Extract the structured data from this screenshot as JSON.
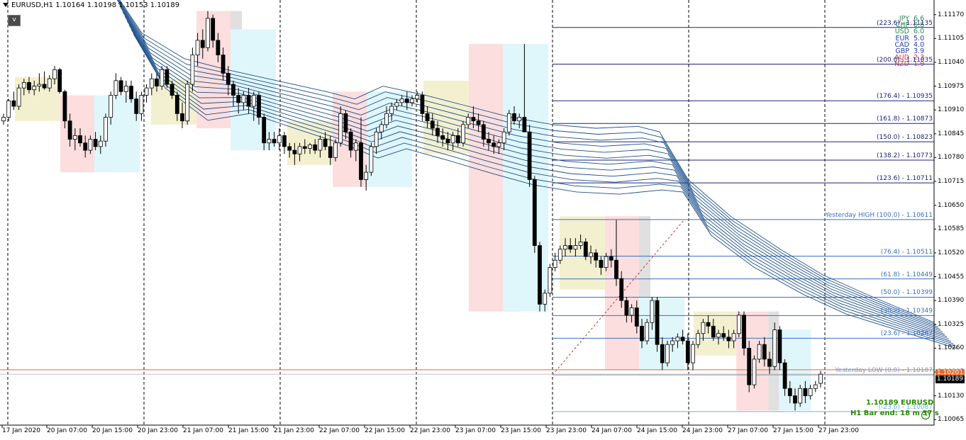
{
  "header": {
    "title": "EURUSD,H1  1.10164 1.10198 1.10153 1.10189"
  },
  "oneclick_label": "v",
  "strength": [
    {
      "ccy": "JPY",
      "val": "6.6",
      "color": "#2e8b57"
    },
    {
      "ccy": "CHF",
      "val": "6.6",
      "color": "#2e8b57"
    },
    {
      "ccy": "USD",
      "val": "6.0",
      "color": "#2e8b57"
    },
    {
      "ccy": "EUR",
      "val": "5.0",
      "color": "#1f3fa8"
    },
    {
      "ccy": "CAD",
      "val": "4.0",
      "color": "#1f3fa8"
    },
    {
      "ccy": "GBP",
      "val": "3.9",
      "color": "#1f3fa8"
    },
    {
      "ccy": "AUD",
      "val": "2.3",
      "color": "#e03030"
    },
    {
      "ccy": "NZD",
      "val": "1.9",
      "color": "#e03030"
    }
  ],
  "fib_levels": [
    {
      "label": "(223.6) - 1.11135",
      "price": 1.11135,
      "color": "#1a237e"
    },
    {
      "label": "(200.0) - 1.11035",
      "price": 1.11035,
      "color": "#1a237e"
    },
    {
      "label": "(176.4) - 1.10935",
      "price": 1.10935,
      "color": "#1a237e"
    },
    {
      "label": "(161.8) - 1.10873",
      "price": 1.10873,
      "color": "#1a237e"
    },
    {
      "label": "(150.0) - 1.10823",
      "price": 1.10823,
      "color": "#1a237e"
    },
    {
      "label": "(138.2) - 1.10773",
      "price": 1.10773,
      "color": "#1a237e"
    },
    {
      "label": "(123.6) - 1.10711",
      "price": 1.10711,
      "color": "#1a237e"
    },
    {
      "label": "Yesterday HIGH (100.0) - 1.10611",
      "price": 1.10611,
      "color": "#3a6fc4"
    },
    {
      "label": "(76.4) - 1.10511",
      "price": 1.10511,
      "color": "#3a6fc4"
    },
    {
      "label": "(61.8) - 1.10449",
      "price": 1.10449,
      "color": "#3a6fc4"
    },
    {
      "label": "(50.0) - 1.10399",
      "price": 1.10399,
      "color": "#3a6fc4"
    },
    {
      "label": "(38.2) - 1.10349",
      "price": 1.10349,
      "color": "#3a6fc4"
    },
    {
      "label": "(23.6) - 1.10287",
      "price": 1.10287,
      "color": "#3a6fc4"
    },
    {
      "label": "Yesterday LOW (0.0) - 1.10187",
      "price": 1.10187,
      "color": "#8899bb"
    },
    {
      "label": "(-23.6) - 1.10087",
      "price": 1.10087,
      "color": "#6ab0e0"
    }
  ],
  "price_ticks": [
    "1.11170",
    "1.11105",
    "1.11040",
    "1.10975",
    "1.10910",
    "1.10845",
    "1.10780",
    "1.10715",
    "1.10650",
    "1.10585",
    "1.10520",
    "1.10455",
    "1.10390",
    "1.10325",
    "1.10260",
    "1.10195",
    "1.10130",
    "1.10065"
  ],
  "time_ticks": [
    "17 Jan 2020",
    "20 Jan 07:00",
    "20 Jan 15:00",
    "20 Jan 23:00",
    "21 Jan 07:00",
    "21 Jan 15:00",
    "21 Jan 23:00",
    "22 Jan 07:00",
    "22 Jan 15:00",
    "22 Jan 23:00",
    "23 Jan 07:00",
    "23 Jan 15:00",
    "23 Jan 23:00",
    "24 Jan 07:00",
    "24 Jan 15:00",
    "24 Jan 23:00",
    "27 Jan 07:00",
    "27 Jan 15:00",
    "27 Jan 23:00"
  ],
  "current_price": {
    "bid": "1.10189",
    "ask": "1.10201"
  },
  "info": {
    "line1": "1.10189  EURUSD",
    "line2": "H1 Bar end: 18 m 37 s"
  },
  "colors": {
    "bull": "#ffffff",
    "bear": "#000000",
    "ribbon": "#1b4f8a",
    "bidline": "#c0c0c0",
    "askline": "#e8692b",
    "session_asia": "#f3f0d0",
    "session_london": "#fcdede",
    "session_ny": "#dff6fb",
    "overlap": "#e0e0e0"
  },
  "chart_data": {
    "type": "candlestick",
    "symbol": "EURUSD",
    "timeframe": "H1",
    "ylim": [
      1.1005,
      1.1121
    ],
    "candles": [
      [
        1.1088,
        1.109,
        1.1087,
        1.1089
      ],
      [
        1.1089,
        1.1094,
        1.1088,
        1.10935
      ],
      [
        1.10935,
        1.1096,
        1.1091,
        1.1092
      ],
      [
        1.1092,
        1.1098,
        1.1091,
        1.1097
      ],
      [
        1.1097,
        1.10995,
        1.1095,
        1.10985
      ],
      [
        1.10985,
        1.11,
        1.10955,
        1.10965
      ],
      [
        1.10965,
        1.1099,
        1.1095,
        1.10975
      ],
      [
        1.10975,
        1.1101,
        1.1096,
        1.1098
      ],
      [
        1.1098,
        1.11015,
        1.10965,
        1.1097
      ],
      [
        1.1097,
        1.11005,
        1.1096,
        1.10995
      ],
      [
        1.10995,
        1.1103,
        1.1098,
        1.1102
      ],
      [
        1.1102,
        1.11025,
        1.10955,
        1.1096
      ],
      [
        1.1096,
        1.10965,
        1.1086,
        1.1088
      ],
      [
        1.1088,
        1.109,
        1.1081,
        1.1083
      ],
      [
        1.1083,
        1.1086,
        1.108,
        1.1084
      ],
      [
        1.1084,
        1.1086,
        1.1081,
        1.1082
      ],
      [
        1.1082,
        1.1084,
        1.1078,
        1.108
      ],
      [
        1.108,
        1.1084,
        1.1079,
        1.1083
      ],
      [
        1.1083,
        1.1085,
        1.108,
        1.1081
      ],
      [
        1.1081,
        1.1084,
        1.1079,
        1.10825
      ],
      [
        1.10825,
        1.109,
        1.1081,
        1.1089
      ],
      [
        1.1089,
        1.1096,
        1.1087,
        1.1095
      ],
      [
        1.1095,
        1.1101,
        1.1094,
        1.1099
      ],
      [
        1.1099,
        1.11,
        1.1095,
        1.1096
      ],
      [
        1.1096,
        1.1099,
        1.1093,
        1.10975
      ],
      [
        1.10975,
        1.1099,
        1.1093,
        1.1094
      ],
      [
        1.1094,
        1.1096,
        1.1088,
        1.109
      ],
      [
        1.109,
        1.1096,
        1.1088,
        1.1095
      ],
      [
        1.1095,
        1.1098,
        1.1093,
        1.1097
      ],
      [
        1.1097,
        1.1101,
        1.1095,
        1.10995
      ],
      [
        1.10995,
        1.1101,
        1.1096,
        1.10975
      ],
      [
        1.10975,
        1.1103,
        1.10965,
        1.1102
      ],
      [
        1.1102,
        1.1103,
        1.1097,
        1.1098
      ],
      [
        1.1098,
        1.1099,
        1.1094,
        1.1095
      ],
      [
        1.1095,
        1.1096,
        1.1088,
        1.109
      ],
      [
        1.109,
        1.1093,
        1.1086,
        1.1088
      ],
      [
        1.1088,
        1.1099,
        1.1087,
        1.1098
      ],
      [
        1.1098,
        1.1108,
        1.1096,
        1.1106
      ],
      [
        1.1106,
        1.1112,
        1.1103,
        1.111
      ],
      [
        1.111,
        1.1113,
        1.1105,
        1.1108
      ],
      [
        1.1108,
        1.1118,
        1.1107,
        1.1116
      ],
      [
        1.1116,
        1.1117,
        1.1108,
        1.111
      ],
      [
        1.111,
        1.1112,
        1.1104,
        1.1106
      ],
      [
        1.1106,
        1.1108,
        1.1099,
        1.1101
      ],
      [
        1.1101,
        1.1103,
        1.1095,
        1.1098
      ],
      [
        1.1098,
        1.1099,
        1.1092,
        1.1095
      ],
      [
        1.1095,
        1.1097,
        1.109,
        1.1093
      ],
      [
        1.1093,
        1.1096,
        1.1091,
        1.1095
      ],
      [
        1.1095,
        1.1097,
        1.109,
        1.1092
      ],
      [
        1.1092,
        1.1096,
        1.1088,
        1.1095
      ],
      [
        1.1095,
        1.1096,
        1.1087,
        1.1089
      ],
      [
        1.1089,
        1.109,
        1.108,
        1.1082
      ],
      [
        1.1082,
        1.1085,
        1.108,
        1.1083
      ],
      [
        1.1083,
        1.1085,
        1.1081,
        1.1082
      ],
      [
        1.1082,
        1.1086,
        1.108,
        1.1084
      ],
      [
        1.1084,
        1.1085,
        1.1079,
        1.1081
      ],
      [
        1.1081,
        1.1082,
        1.1078,
        1.108
      ],
      [
        1.108,
        1.1082,
        1.1076,
        1.1079
      ],
      [
        1.1079,
        1.1082,
        1.1077,
        1.1081
      ],
      [
        1.1081,
        1.1083,
        1.1079,
        1.10805
      ],
      [
        1.10805,
        1.1082,
        1.1079,
        1.10815
      ],
      [
        1.10815,
        1.1083,
        1.1079,
        1.108
      ],
      [
        1.108,
        1.1084,
        1.1078,
        1.1083
      ],
      [
        1.1083,
        1.1085,
        1.108,
        1.1081
      ],
      [
        1.1081,
        1.1084,
        1.1076,
        1.1078
      ],
      [
        1.1078,
        1.1083,
        1.1077,
        1.1082
      ],
      [
        1.1082,
        1.1092,
        1.1081,
        1.109
      ],
      [
        1.109,
        1.1091,
        1.1083,
        1.1085
      ],
      [
        1.1085,
        1.1086,
        1.1078,
        1.108
      ],
      [
        1.108,
        1.1083,
        1.1077,
        1.1082
      ],
      [
        1.1082,
        1.1089,
        1.107,
        1.1072
      ],
      [
        1.1072,
        1.1076,
        1.1069,
        1.1074
      ],
      [
        1.1074,
        1.1082,
        1.1073,
        1.1081
      ],
      [
        1.1081,
        1.1086,
        1.1079,
        1.1085
      ],
      [
        1.1085,
        1.1088,
        1.1083,
        1.1087
      ],
      [
        1.1087,
        1.1092,
        1.1086,
        1.109
      ],
      [
        1.109,
        1.1093,
        1.1088,
        1.1092
      ],
      [
        1.1092,
        1.1094,
        1.1091,
        1.1093
      ],
      [
        1.1093,
        1.1095,
        1.1092,
        1.1094
      ],
      [
        1.1094,
        1.1096,
        1.1091,
        1.1093
      ],
      [
        1.1093,
        1.1095,
        1.1092,
        1.1094
      ],
      [
        1.1094,
        1.1096,
        1.1093,
        1.1095
      ],
      [
        1.1095,
        1.1096,
        1.1088,
        1.109
      ],
      [
        1.109,
        1.1092,
        1.1086,
        1.1088
      ],
      [
        1.1088,
        1.109,
        1.1084,
        1.1086
      ],
      [
        1.1086,
        1.1088,
        1.1082,
        1.1084
      ],
      [
        1.1084,
        1.1086,
        1.1081,
        1.1083
      ],
      [
        1.1083,
        1.1085,
        1.108,
        1.1082
      ],
      [
        1.1082,
        1.1085,
        1.108,
        1.1084
      ],
      [
        1.1084,
        1.1086,
        1.1081,
        1.1082
      ],
      [
        1.1082,
        1.1088,
        1.1081,
        1.1087
      ],
      [
        1.1087,
        1.109,
        1.1086,
        1.1089
      ],
      [
        1.1089,
        1.1092,
        1.1086,
        1.1088
      ],
      [
        1.1088,
        1.109,
        1.1085,
        1.1087
      ],
      [
        1.1087,
        1.1088,
        1.1081,
        1.1083
      ],
      [
        1.1083,
        1.1085,
        1.108,
        1.1082
      ],
      [
        1.1082,
        1.1084,
        1.1079,
        1.1081
      ],
      [
        1.1081,
        1.1083,
        1.1079,
        1.1082
      ],
      [
        1.1082,
        1.1086,
        1.108,
        1.1085
      ],
      [
        1.1085,
        1.1091,
        1.1084,
        1.109
      ],
      [
        1.109,
        1.1092,
        1.1087,
        1.1088
      ],
      [
        1.1088,
        1.109,
        1.1086,
        1.1089
      ],
      [
        1.1089,
        1.1109,
        1.1088,
        1.1085
      ],
      [
        1.1085,
        1.1087,
        1.107,
        1.1072
      ],
      [
        1.1072,
        1.1073,
        1.1052,
        1.1054
      ],
      [
        1.1054,
        1.1055,
        1.1036,
        1.1038
      ],
      [
        1.1038,
        1.1042,
        1.1036,
        1.1041
      ],
      [
        1.1041,
        1.1049,
        1.104,
        1.1048
      ],
      [
        1.1048,
        1.1052,
        1.1047,
        1.105
      ],
      [
        1.105,
        1.1054,
        1.1049,
        1.1053
      ],
      [
        1.1053,
        1.1056,
        1.1051,
        1.1054
      ],
      [
        1.1054,
        1.1056,
        1.1052,
        1.1053
      ],
      [
        1.1053,
        1.1056,
        1.1051,
        1.1054
      ],
      [
        1.1054,
        1.1057,
        1.1053,
        1.1055
      ],
      [
        1.1055,
        1.1056,
        1.105,
        1.1051
      ],
      [
        1.1051,
        1.1054,
        1.1049,
        1.1052
      ],
      [
        1.1052,
        1.1053,
        1.1048,
        1.105
      ],
      [
        1.105,
        1.1051,
        1.1046,
        1.1048
      ],
      [
        1.1048,
        1.1052,
        1.1047,
        1.1051
      ],
      [
        1.1051,
        1.1053,
        1.1048,
        1.105
      ],
      [
        1.105,
        1.1061,
        1.1043,
        1.1045
      ],
      [
        1.1045,
        1.1047,
        1.1037,
        1.1039
      ],
      [
        1.1039,
        1.104,
        1.1033,
        1.1035
      ],
      [
        1.1035,
        1.1038,
        1.1033,
        1.1037
      ],
      [
        1.1037,
        1.1039,
        1.103,
        1.1032
      ],
      [
        1.1032,
        1.1034,
        1.1026,
        1.1028
      ],
      [
        1.1028,
        1.1034,
        1.1027,
        1.1033
      ],
      [
        1.1033,
        1.104,
        1.1031,
        1.1039
      ],
      [
        1.1039,
        1.104,
        1.1025,
        1.1027
      ],
      [
        1.1027,
        1.1029,
        1.102,
        1.1022
      ],
      [
        1.1022,
        1.1028,
        1.1021,
        1.1027
      ],
      [
        1.1027,
        1.1029,
        1.1025,
        1.1028
      ],
      [
        1.1028,
        1.103,
        1.1026,
        1.1029
      ],
      [
        1.1029,
        1.1031,
        1.1027,
        1.1028
      ],
      [
        1.1028,
        1.103,
        1.102,
        1.1022
      ],
      [
        1.1022,
        1.1028,
        1.102,
        1.1027
      ],
      [
        1.1027,
        1.1031,
        1.1026,
        1.103
      ],
      [
        1.103,
        1.1034,
        1.1028,
        1.1033
      ],
      [
        1.1033,
        1.1035,
        1.103,
        1.1032
      ],
      [
        1.1032,
        1.1034,
        1.1028,
        1.1029
      ],
      [
        1.1029,
        1.1031,
        1.1027,
        1.103
      ],
      [
        1.103,
        1.1032,
        1.1028,
        1.1029
      ],
      [
        1.1029,
        1.1031,
        1.1026,
        1.1028
      ],
      [
        1.1028,
        1.1031,
        1.1026,
        1.103
      ],
      [
        1.103,
        1.1036,
        1.1029,
        1.1035
      ],
      [
        1.1035,
        1.1036,
        1.1024,
        1.1026
      ],
      [
        1.1026,
        1.1028,
        1.1014,
        1.1016
      ],
      [
        1.1016,
        1.1024,
        1.1015,
        1.1023
      ],
      [
        1.1023,
        1.1028,
        1.1022,
        1.1027
      ],
      [
        1.1027,
        1.1029,
        1.1021,
        1.1023
      ],
      [
        1.1023,
        1.1025,
        1.1019,
        1.1021
      ],
      [
        1.1021,
        1.1033,
        1.102,
        1.1031
      ],
      [
        1.1031,
        1.1032,
        1.102,
        1.1022
      ],
      [
        1.1022,
        1.1023,
        1.1013,
        1.1015
      ],
      [
        1.1015,
        1.1017,
        1.1011,
        1.1013
      ],
      [
        1.1013,
        1.1015,
        1.1009,
        1.1011
      ],
      [
        1.1011,
        1.1016,
        1.101,
        1.1015
      ],
      [
        1.1015,
        1.1017,
        1.1011,
        1.1013
      ],
      [
        1.1013,
        1.1016,
        1.1012,
        1.1015
      ],
      [
        1.1015,
        1.1017,
        1.1014,
        1.1016
      ],
      [
        1.10164,
        1.10198,
        1.10153,
        1.10189
      ]
    ]
  }
}
